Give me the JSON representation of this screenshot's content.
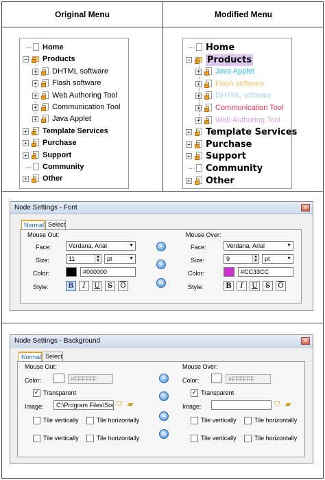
{
  "headers": {
    "original": "Original Menu",
    "modified": "Modified Menu"
  },
  "original_tree": [
    {
      "label": "Home",
      "level": 0
    },
    {
      "label": "Products",
      "level": 0
    },
    {
      "label": "DHTML software",
      "level": 1
    },
    {
      "label": "Flash software",
      "level": 1
    },
    {
      "label": "Web Authoring Tool",
      "level": 1
    },
    {
      "label": "Communication Tool",
      "level": 1
    },
    {
      "label": "Java Applet",
      "level": 1
    },
    {
      "label": "Template Services",
      "level": 0
    },
    {
      "label": "Purchase",
      "level": 0
    },
    {
      "label": "Support",
      "level": 0
    },
    {
      "label": "Community",
      "level": 0
    },
    {
      "label": "Other",
      "level": 0
    }
  ],
  "modified_tree": [
    {
      "label": "Home",
      "level": 0,
      "color": "#000000"
    },
    {
      "label": "Products",
      "level": 0,
      "color": "#000000",
      "highlight": "#dcc7ef"
    },
    {
      "label": "Java Applet",
      "level": 1,
      "color": "#33c3e8"
    },
    {
      "label": "Flash software",
      "level": 1,
      "color": "#f5c46a"
    },
    {
      "label": "DHTML software",
      "level": 1,
      "color": "#a9d3f0"
    },
    {
      "label": "Communication Tool",
      "level": 1,
      "color": "#e8334f"
    },
    {
      "label": "Web Authoring Tool",
      "level": 1,
      "color": "#cfa3e6"
    },
    {
      "label": "Template Services",
      "level": 0,
      "color": "#000000"
    },
    {
      "label": "Purchase",
      "level": 0,
      "color": "#000000"
    },
    {
      "label": "Support",
      "level": 0,
      "color": "#000000"
    },
    {
      "label": "Community",
      "level": 0,
      "color": "#000000"
    },
    {
      "label": "Other",
      "level": 0,
      "color": "#000000"
    }
  ],
  "font_dialog": {
    "title": "Node Settings - Font",
    "tabs": [
      "Normal",
      "Select"
    ],
    "mouse_out": {
      "heading": "Mouse Out:",
      "face_label": "Face:",
      "face_value": "Verdana, Arial",
      "size_label": "Size:",
      "size_value": "11",
      "unit_value": "pt",
      "color_label": "Color:",
      "color_value": "#000000",
      "swatch": "#000000",
      "style_label": "Style:"
    },
    "mouse_over": {
      "heading": "Mouse Over:",
      "face_label": "Face:",
      "face_value": "Verdana, Arial",
      "size_label": "Size:",
      "size_value": "9",
      "unit_value": "pt",
      "color_label": "Color:",
      "color_value": "#CC33CC",
      "swatch": "#cc33cc",
      "style_label": "Style:"
    },
    "style_buttons": [
      "B",
      "I",
      "U",
      "S",
      "O"
    ]
  },
  "bg_dialog": {
    "title": "Node Settings - Background",
    "tabs": [
      "Normal",
      "Select"
    ],
    "mouse_out": {
      "heading": "Mouse Out:",
      "color_label": "Color:",
      "color_value": "#FFFFFF",
      "transparent_label": "Transparent",
      "image_label": "Image:",
      "image_value": "C:\\Program Files\\Sourc",
      "tile_v": "Tile vertically",
      "tile_h": "Tile horizontally"
    },
    "mouse_over": {
      "heading": "Mouse Over:",
      "color_label": "Color:",
      "color_value": "#FFFFFF",
      "transparent_label": "Transparent",
      "image_label": "Image:",
      "image_value": "",
      "tile_v": "Tile vertically",
      "tile_h": "Tile horizontally"
    }
  }
}
